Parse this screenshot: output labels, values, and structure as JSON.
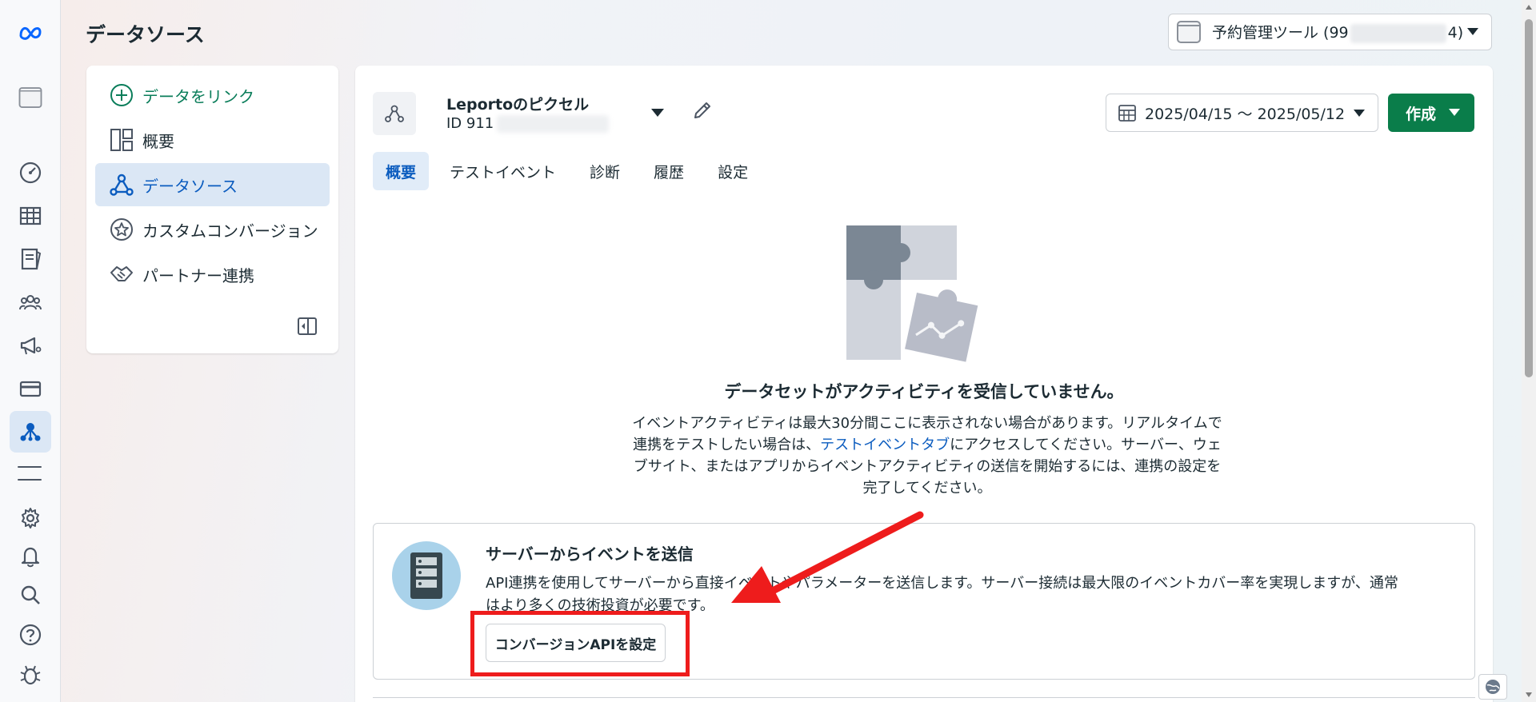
{
  "header": {
    "title": "データソース",
    "account": {
      "label_prefix": "予約管理ツール (99",
      "label_suffix": "4)"
    }
  },
  "rail": {
    "icons": [
      "meta-logo-icon",
      "business-account-icon",
      "dashboard-icon",
      "table-icon",
      "catalog-icon",
      "audience-icon",
      "ads-icon",
      "billing-icon",
      "data-sources-icon",
      "menu-icon",
      "settings-icon",
      "notifications-icon",
      "search-icon",
      "help-icon",
      "debug-icon"
    ]
  },
  "nav": {
    "link_data": "データをリンク",
    "overview": "概要",
    "data_sources": "データソース",
    "custom_conversions": "カスタムコンバージョン",
    "partner_integrations": "パートナー連携"
  },
  "pixel": {
    "name": "Leportoのピクセル",
    "id_prefix": "ID 911"
  },
  "toolbar": {
    "date_range": "2025/04/15 〜 2025/05/12",
    "create_label": "作成"
  },
  "tabs": [
    "概要",
    "テストイベント",
    "診断",
    "履歴",
    "設定"
  ],
  "empty_state": {
    "title": "データセットがアクティビティを受信していません。",
    "desc_1": "イベントアクティビティは最大30分間ここに表示されない場合があります。リアルタイムで",
    "desc_2a": "連携をテストしたい場合は、",
    "desc_link": "テストイベントタブ",
    "desc_2b": "にアクセスしてください。サーバー、ウェ",
    "desc_3": "ブサイト、またはアプリからイベントアクティビティの送信を開始するには、連携の設定を",
    "desc_4": "完了してください。"
  },
  "server_card": {
    "title": "サーバーからイベントを送信",
    "desc_1": "API連携を使用してサーバーから直接イベントやパラメーターを送信します。サーバー接続は最大限のイベントカバー率を実現しますが、通常",
    "desc_2": "はより多くの技術投資が必要です。",
    "button": "コンバージョンAPIを設定"
  },
  "colors": {
    "accent_blue": "#0b5cbf",
    "create_green": "#0a7d4a",
    "link_green": "#0a7d5a",
    "highlight_red": "#ee1c1c"
  }
}
